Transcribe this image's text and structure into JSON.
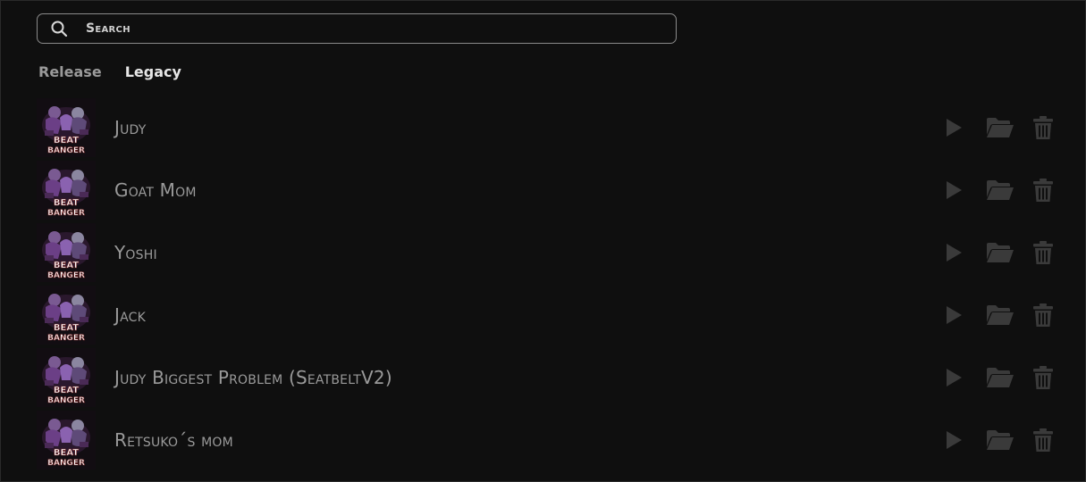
{
  "search": {
    "placeholder": "Search",
    "icon": "search-icon"
  },
  "tabs": [
    {
      "label": "Release",
      "active": false
    },
    {
      "label": "Legacy",
      "active": true
    }
  ],
  "thumbnail": {
    "text_line1": "BEAT",
    "text_line2": "BANGER"
  },
  "icons": {
    "play": "play-icon",
    "folder": "folder-open-icon",
    "delete": "trash-icon"
  },
  "colors": {
    "background": "#0f0f0f",
    "icon": "#3a3a3a",
    "text_muted": "#9a9a9a",
    "text_active": "#e6e6e6"
  },
  "items": [
    {
      "name": "Judy"
    },
    {
      "name": "Goat Mom"
    },
    {
      "name": "Yoshi"
    },
    {
      "name": "Jack"
    },
    {
      "name": "Judy Biggest Problem (SeatbeltV2)"
    },
    {
      "name": "Retsuko´s mom"
    }
  ]
}
